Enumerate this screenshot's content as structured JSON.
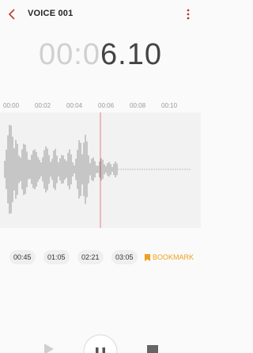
{
  "header": {
    "title": "VOICE 001",
    "back_icon": "chevron-left-icon",
    "menu_icon": "more-vertical-icon",
    "accent": "#c0392b"
  },
  "timer": {
    "elapsed_dim": "00:0",
    "elapsed_lit": "6.10"
  },
  "ruler": {
    "labels": [
      "00:00",
      "00:02",
      "00:04",
      "00:06",
      "00:08",
      "00:10"
    ]
  },
  "waveform": {
    "playhead_color": "#e57f93",
    "bar_color": "#9a9a9a"
  },
  "bookmarks": {
    "times": [
      "00:45",
      "01:05",
      "02:21",
      "03:05"
    ],
    "add_label": "BOOKMARK",
    "add_icon": "bookmark-icon",
    "accent": "#f0a020"
  },
  "controls": {
    "play_icon": "play-icon",
    "pause_icon": "pause-icon",
    "stop_icon": "stop-icon"
  }
}
